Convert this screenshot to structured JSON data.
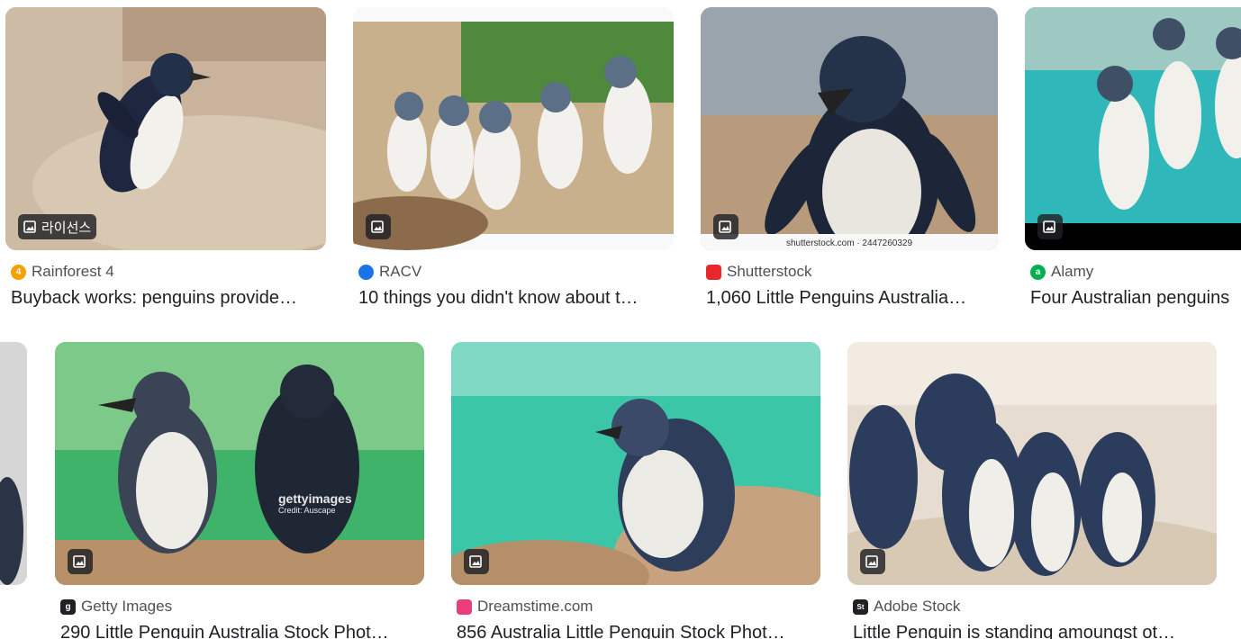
{
  "results": [
    {
      "source": "Rainforest 4",
      "title": "Buyback works: penguins provide…",
      "badge_label": "라이선스",
      "favicon_icon": "rainforest-4-logo",
      "favicon_text": "4",
      "favicon_color": "#f4a100"
    },
    {
      "source": "RACV",
      "title": "10 things you didn't know about t…",
      "badge_label": "",
      "favicon_icon": "racv-logo",
      "favicon_text": "",
      "favicon_color": "#1a73e8"
    },
    {
      "source": "Shutterstock",
      "title": "1,060 Little Penguins Australia…",
      "badge_label": "",
      "watermark": "shutterstock.com · 2447260329",
      "favicon_icon": "shutterstock-logo",
      "favicon_text": "",
      "favicon_color": "#e8282b"
    },
    {
      "source": "Alamy",
      "title": "Four Australian penguins",
      "badge_label": "",
      "favicon_icon": "alamy-logo",
      "favicon_text": "a",
      "favicon_color": "#00b050"
    },
    {
      "source": "Getty Images",
      "title": "290 Little Penguin Australia Stock Phot…",
      "badge_label": "",
      "watermark": "gettyimages",
      "watermark_credit": "Credit: Auscape",
      "favicon_icon": "getty-images-logo",
      "favicon_text": "g",
      "favicon_color": "#202124"
    },
    {
      "source": "Dreamstime.com",
      "title": "856 Australia Little Penguin Stock Phot…",
      "badge_label": "",
      "favicon_icon": "dreamstime-logo",
      "favicon_text": "",
      "favicon_color": "#ea3e7a"
    },
    {
      "source": "Adobe Stock",
      "title": "Little Penguin is standing amoungst ot…",
      "badge_label": "",
      "favicon_icon": "adobe-stock-logo",
      "favicon_text": "St",
      "favicon_color": "#202124"
    }
  ]
}
